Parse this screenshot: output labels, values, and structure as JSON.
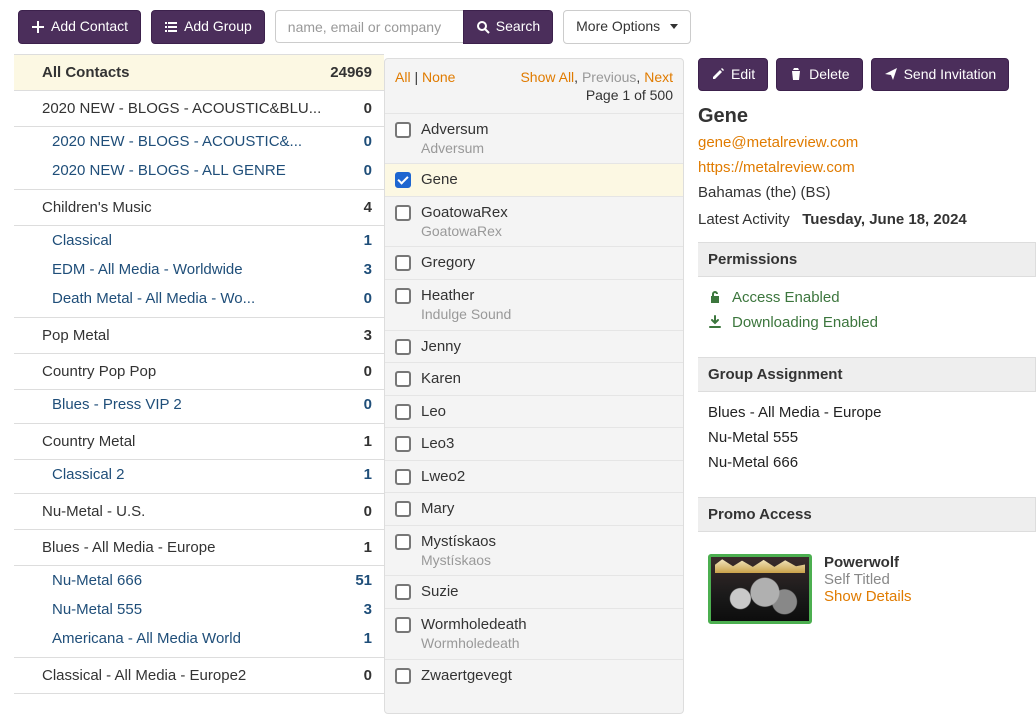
{
  "topbar": {
    "add_contact": "Add Contact",
    "add_group": "Add Group",
    "search_placeholder": "name, email or company",
    "search_button": "Search",
    "more_options": "More Options"
  },
  "sidebar": {
    "all_contacts_label": "All Contacts",
    "all_contacts_count": "24969",
    "groups": [
      {
        "label": "2020 NEW - BLOGS - ACOUSTIC&BLU...",
        "count": "0",
        "subs": [
          {
            "label": "2020 NEW - BLOGS - ACOUSTIC&...",
            "count": "0"
          },
          {
            "label": "2020 NEW - BLOGS - ALL GENRE",
            "count": "0"
          }
        ]
      },
      {
        "label": "Children's Music",
        "count": "4",
        "subs": [
          {
            "label": "Classical",
            "count": "1"
          },
          {
            "label": "EDM - All Media - Worldwide",
            "count": "3"
          },
          {
            "label": "Death Metal - All Media - Wo...",
            "count": "0"
          }
        ]
      },
      {
        "label": "Pop Metal",
        "count": "3",
        "subs": []
      },
      {
        "label": "Country Pop Pop",
        "count": "0",
        "subs": [
          {
            "label": "Blues - Press VIP 2",
            "count": "0"
          }
        ]
      },
      {
        "label": "Country Metal",
        "count": "1",
        "subs": [
          {
            "label": "Classical 2",
            "count": "1"
          }
        ]
      },
      {
        "label": "Nu-Metal - U.S.",
        "count": "0",
        "subs": []
      },
      {
        "label": "Blues - All Media - Europe",
        "count": "1",
        "subs": [
          {
            "label": "Nu-Metal 666",
            "count": "51"
          },
          {
            "label": "Nu-Metal 555",
            "count": "3"
          },
          {
            "label": "Americana - All Media World",
            "count": "1"
          }
        ]
      },
      {
        "label": "Classical - All Media - Europe2",
        "count": "0",
        "subs": []
      }
    ]
  },
  "midpane": {
    "all": "All",
    "none": "None",
    "show_all": "Show All",
    "previous": "Previous",
    "next": "Next",
    "page_label": "Page 1 of 500",
    "contacts": [
      {
        "name": "Adversum",
        "sub": "Adversum",
        "selected": false
      },
      {
        "name": "Gene",
        "sub": "",
        "selected": true
      },
      {
        "name": "GoatowaRex",
        "sub": "GoatowaRex",
        "selected": false
      },
      {
        "name": "Gregory",
        "sub": "",
        "selected": false
      },
      {
        "name": "Heather",
        "sub": "Indulge Sound",
        "selected": false
      },
      {
        "name": "Jenny",
        "sub": "",
        "selected": false
      },
      {
        "name": "Karen",
        "sub": "",
        "selected": false
      },
      {
        "name": "Leo",
        "sub": "",
        "selected": false
      },
      {
        "name": "Leo3",
        "sub": "",
        "selected": false
      },
      {
        "name": "Lweo2",
        "sub": "",
        "selected": false
      },
      {
        "name": "Mary",
        "sub": "",
        "selected": false
      },
      {
        "name": "Mystískaos",
        "sub": "Mystískaos",
        "selected": false
      },
      {
        "name": "Suzie",
        "sub": "",
        "selected": false
      },
      {
        "name": "Wormholedeath",
        "sub": "Wormholedeath",
        "selected": false
      },
      {
        "name": "Zwaertgevegt",
        "sub": "",
        "selected": false
      }
    ]
  },
  "detail": {
    "actions": {
      "edit": "Edit",
      "delete": "Delete",
      "send_invitation": "Send Invitation"
    },
    "name": "Gene",
    "email": "gene@metalreview.com",
    "website": "https://metalreview.com",
    "location": "Bahamas (the) (BS)",
    "activity_label": "Latest Activity",
    "activity_value": "Tuesday, June 18, 2024",
    "permissions_header": "Permissions",
    "permissions": [
      {
        "icon": "unlock",
        "label": "Access Enabled"
      },
      {
        "icon": "download",
        "label": "Downloading Enabled"
      }
    ],
    "group_assignment_header": "Group Assignment",
    "group_assignments": [
      "Blues - All Media - Europe",
      "Nu-Metal 555",
      "Nu-Metal 666"
    ],
    "promo_header": "Promo Access",
    "promo": {
      "title": "Powerwolf",
      "subtitle": "Self Titled",
      "details": "Show Details"
    }
  }
}
